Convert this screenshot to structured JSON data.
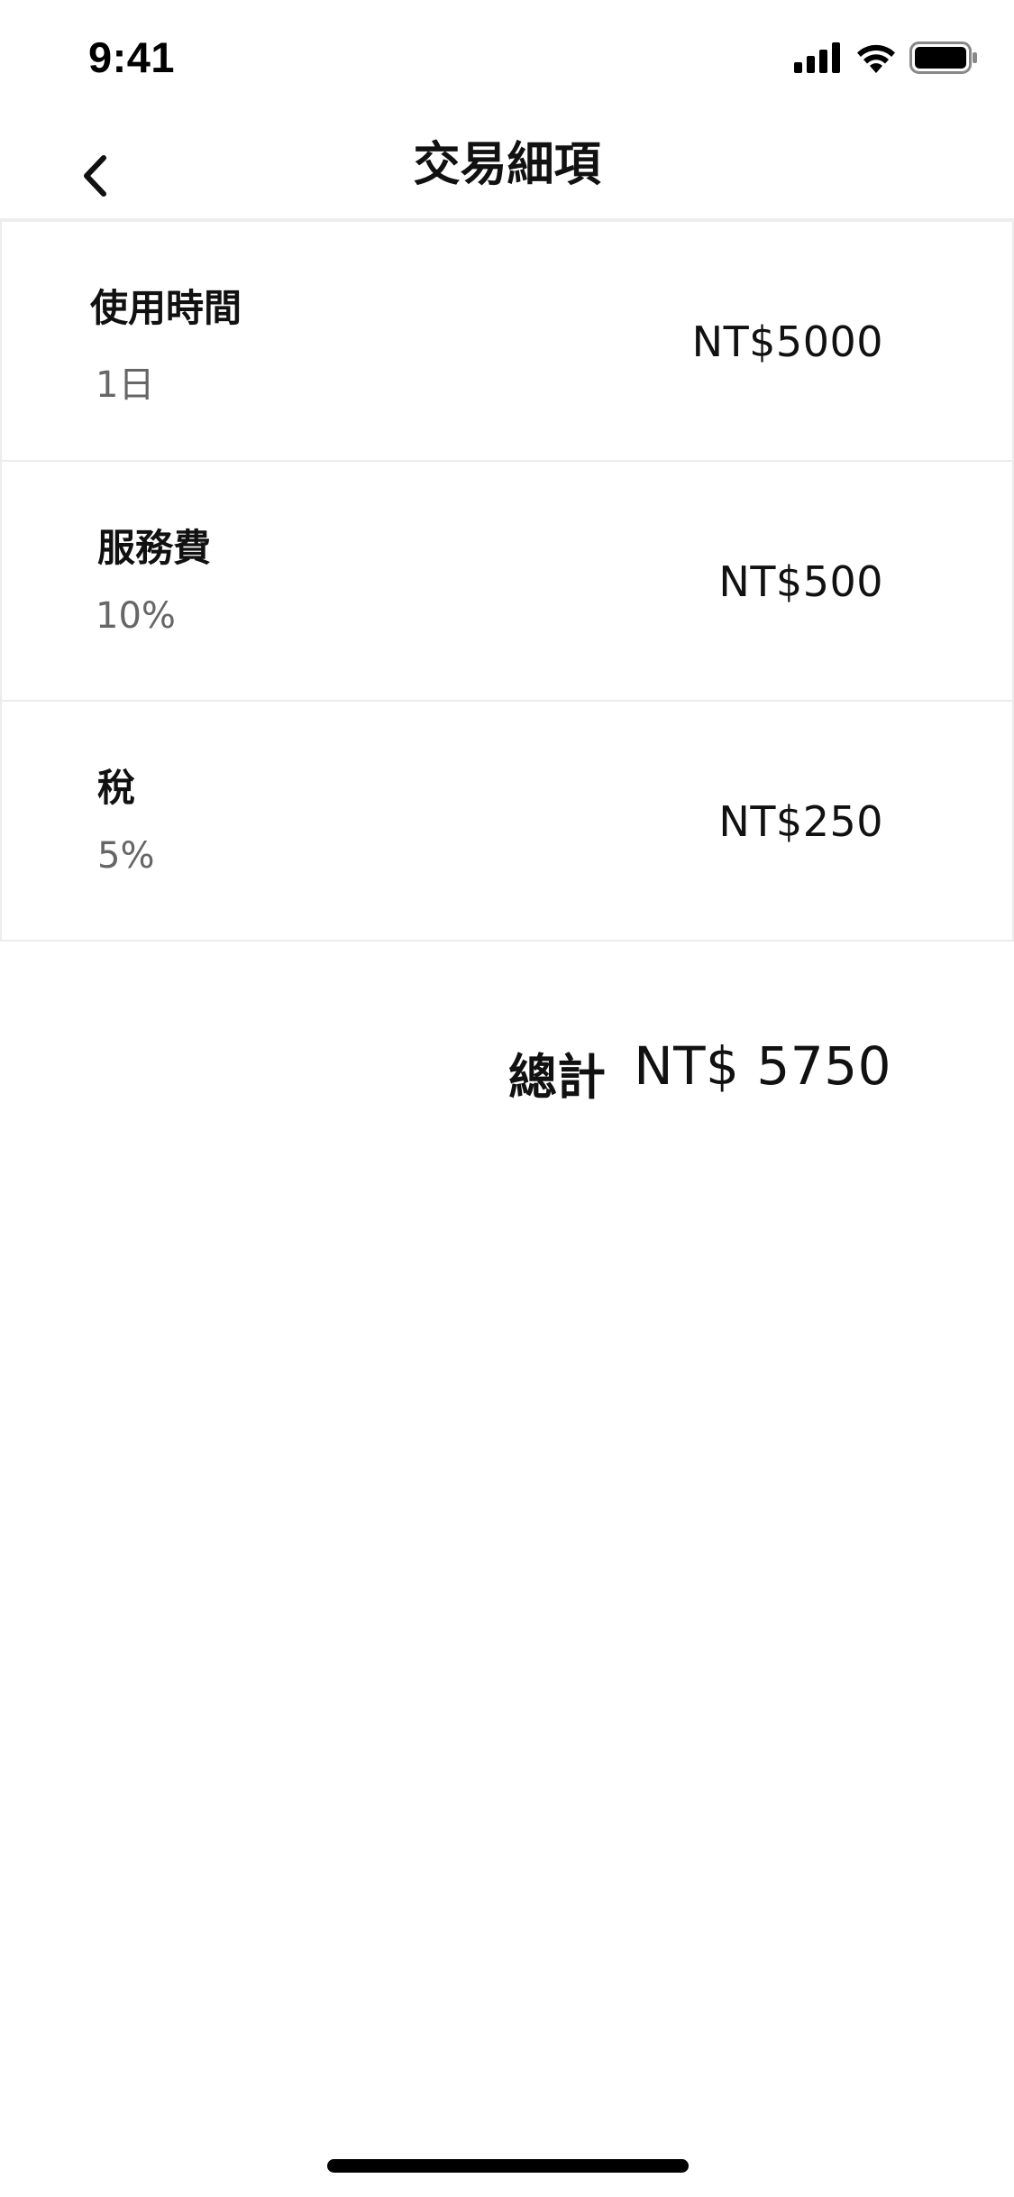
{
  "status_bar": {
    "time": "9:41",
    "icons": [
      "cellular-signal-icon",
      "wifi-icon",
      "battery-icon"
    ]
  },
  "header": {
    "back_icon": "chevron-left-icon",
    "title": "交易細項"
  },
  "items": [
    {
      "name": "使用時間",
      "detail": "1日",
      "amount": "NT$5000"
    },
    {
      "name": "服務費",
      "detail": "10%",
      "amount": "NT$500"
    },
    {
      "name": "稅",
      "detail": "5%",
      "amount": "NT$250"
    }
  ],
  "total": {
    "label": "總計",
    "value": "NT$ 5750"
  },
  "colors": {
    "text_primary": "#111111",
    "text_secondary": "#666666",
    "divider": "#ececec",
    "background": "#ffffff"
  }
}
